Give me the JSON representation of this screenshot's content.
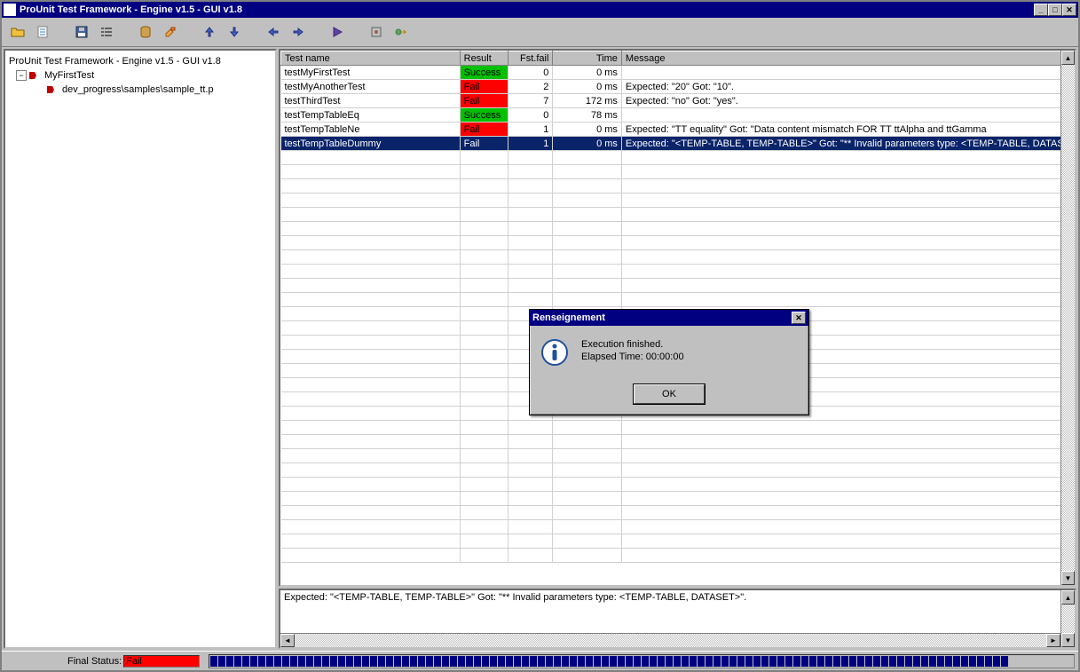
{
  "window": {
    "title": "ProUnit Test Framework - Engine v1.5  - GUI v1.8"
  },
  "tree": {
    "root": "ProUnit Test Framework - Engine v1.5  - GUI v1.8",
    "items": [
      {
        "label": "MyFirstTest"
      },
      {
        "label": "dev_progress\\samples\\sample_tt.p"
      }
    ]
  },
  "grid": {
    "cols": {
      "name": "Test name",
      "result": "Result",
      "fstfail": "Fst.fail",
      "time": "Time",
      "message": "Message"
    },
    "rows": [
      {
        "name": "testMyFirstTest",
        "result": "Success",
        "status": "success",
        "fstfail": "0",
        "time": "0 ms",
        "message": ""
      },
      {
        "name": "testMyAnotherTest",
        "result": "Fail",
        "status": "fail",
        "fstfail": "2",
        "time": "0 ms",
        "message": "Expected: \"20\" Got: \"10\"."
      },
      {
        "name": "testThirdTest",
        "result": "Fail",
        "status": "fail",
        "fstfail": "7",
        "time": "172 ms",
        "message": "Expected: \"no\" Got: \"yes\"."
      },
      {
        "name": "testTempTableEq",
        "result": "Success",
        "status": "success",
        "fstfail": "0",
        "time": "78 ms",
        "message": ""
      },
      {
        "name": "testTempTableNe",
        "result": "Fail",
        "status": "fail",
        "fstfail": "1",
        "time": "0 ms",
        "message": "Expected: \"TT equality\" Got: \"Data content mismatch FOR TT ttAlpha and ttGamma"
      },
      {
        "name": "testTempTableDummy",
        "result": "Fail",
        "status": "fail",
        "fstfail": "1",
        "time": "0 ms",
        "message": "Expected: \"<TEMP-TABLE, TEMP-TABLE>\" Got: \"** Invalid parameters type: <TEMP-TABLE, DATASE",
        "selected": true
      }
    ]
  },
  "detail": {
    "text": "Expected: \"<TEMP-TABLE, TEMP-TABLE>\" Got: \"** Invalid parameters type: <TEMP-TABLE, DATASET>\"."
  },
  "status": {
    "label": "Final Status:",
    "value": "Fail"
  },
  "dialog": {
    "title": "Renseignement",
    "line1": "Execution finished.",
    "line2": "Elapsed Time: 00:00:00",
    "ok": "OK"
  }
}
